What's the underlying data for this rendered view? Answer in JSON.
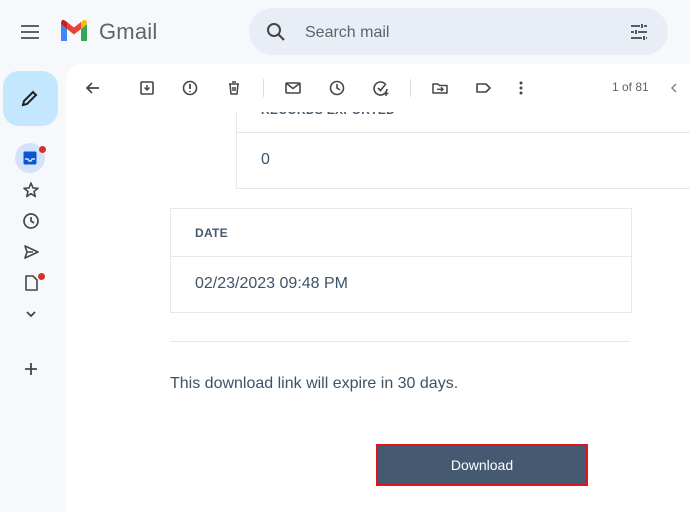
{
  "header": {
    "brand": "Gmail",
    "search_placeholder": "Search mail"
  },
  "toolbar": {
    "pager": "1 of 81"
  },
  "email": {
    "records_label": "RECORDS EXPORTED",
    "records_value": "0",
    "date_label": "DATE",
    "date_value": "02/23/2023 09:48 PM",
    "expire_text": "This download link will expire in 30 days.",
    "download_label": "Download"
  },
  "colors": {
    "compose_bg": "#c2e7ff",
    "search_bg": "#e9eef6",
    "download_bg": "#455a70",
    "download_highlight": "#e2141b",
    "badge": "#d93025"
  },
  "icons": {
    "header": [
      "menu-icon",
      "gmail-logo-icon",
      "search-icon",
      "search-options-icon"
    ],
    "rail": [
      "pencil-icon",
      "inbox-icon",
      "star-icon",
      "clock-icon",
      "send-icon",
      "draft-icon",
      "chevron-down-icon",
      "plus-icon"
    ],
    "toolbar": [
      "back-arrow-icon",
      "archive-icon",
      "report-spam-icon",
      "delete-icon",
      "mark-unread-icon",
      "snooze-icon",
      "add-task-icon",
      "move-to-icon",
      "label-icon",
      "more-vert-icon",
      "chevron-left-icon"
    ]
  }
}
